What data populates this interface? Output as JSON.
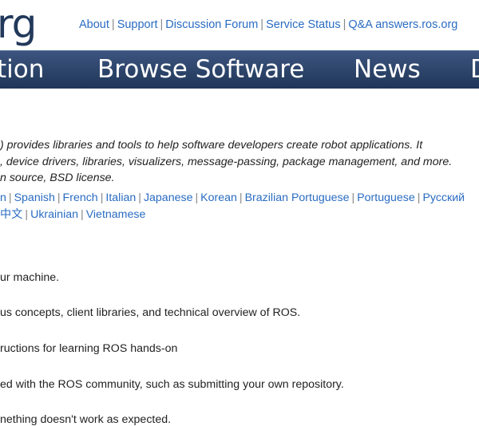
{
  "header": {
    "logo_fragment": "rg",
    "top_links": [
      "About",
      "Support",
      "Discussion Forum",
      "Service Status",
      "Q&A answers.ros.org"
    ]
  },
  "nav": {
    "items": [
      "tion",
      "Browse Software",
      "News",
      "D"
    ]
  },
  "intro": {
    "lines": [
      ") provides libraries and tools to help software developers create robot applications. It",
      ", device drivers, libraries, visualizers, message-passing, package management, and more.",
      "n source, BSD license."
    ]
  },
  "languages": {
    "row1": [
      "n",
      "Spanish",
      "French",
      "Italian",
      "Japanese",
      "Korean",
      "Brazilian Portuguese",
      "Portuguese",
      "Русский"
    ],
    "row2": [
      "中文",
      "Ukrainian",
      "Vietnamese"
    ]
  },
  "sections": [
    "ur machine.",
    "us concepts, client libraries, and technical overview of ROS.",
    "ructions for learning ROS hands-on",
    "ed with the ROS community, such as submitting your own repository.",
    "nething doesn't work as expected."
  ]
}
